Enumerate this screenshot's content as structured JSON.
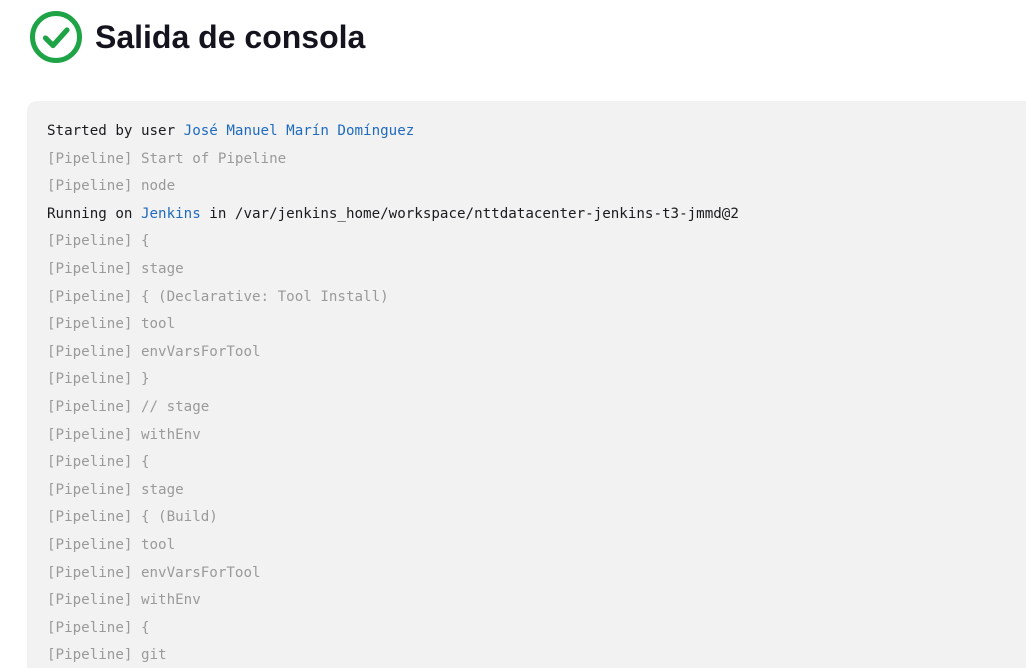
{
  "page": {
    "title": "Salida de consola",
    "status_icon": "success-check-icon",
    "colors": {
      "success": "#1ea446",
      "link": "#1f6bbf",
      "pipeline_text": "#9a9a9a",
      "console_bg": "#f2f2f2"
    }
  },
  "console": {
    "started_prefix": "Started by user ",
    "started_user": "José Manuel Marín Domínguez",
    "running_prefix": "Running on ",
    "running_node": "Jenkins",
    "running_suffix": " in /var/jenkins_home/workspace/nttdatacenter-jenkins-t3-jmmd@2",
    "pipeline_lines": {
      "l2": "[Pipeline] Start of Pipeline",
      "l3": "[Pipeline] node",
      "l5": "[Pipeline] {",
      "l6": "[Pipeline] stage",
      "l7": "[Pipeline] { (Declarative: Tool Install)",
      "l8": "[Pipeline] tool",
      "l9": "[Pipeline] envVarsForTool",
      "l10": "[Pipeline] }",
      "l11": "[Pipeline] // stage",
      "l12": "[Pipeline] withEnv",
      "l13": "[Pipeline] {",
      "l14": "[Pipeline] stage",
      "l15": "[Pipeline] { (Build)",
      "l16": "[Pipeline] tool",
      "l17": "[Pipeline] envVarsForTool",
      "l18": "[Pipeline] withEnv",
      "l19": "[Pipeline] {",
      "l20": "[Pipeline] git"
    }
  }
}
